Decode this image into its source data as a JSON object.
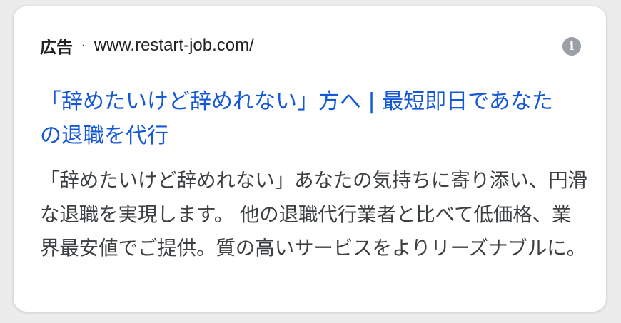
{
  "ad": {
    "label": "広告",
    "separator": "·",
    "display_url": "www.restart-job.com/",
    "info_icon": "info-icon",
    "headline": "「辞めたいけど辞めれない」方へ | 最短即日であなたの退職を代行",
    "description": "「辞めたいけど辞めれない」あなたの気持ちに寄り添い、円滑な退職を実現します。 他の退職代行業者と比べて低価格、業界最安値でご提供。質の高いサービスをよりリーズナブルに。"
  },
  "colors": {
    "link": "#1558d6",
    "text": "#3c4043",
    "icon": "#9aa0a6",
    "background": "#ececec",
    "card": "#ffffff"
  }
}
